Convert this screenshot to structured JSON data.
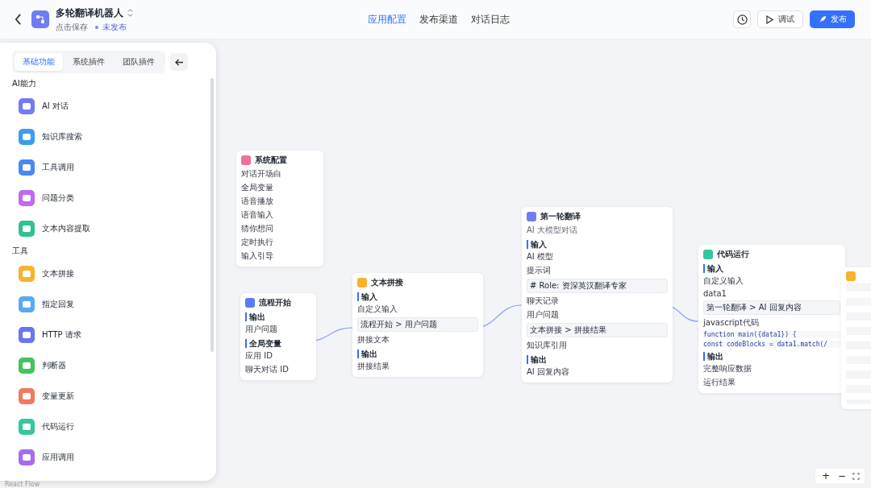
{
  "header": {
    "title": "多轮翻译机器人",
    "save_hint": "点击保存",
    "status": "未发布"
  },
  "tabs": [
    {
      "label": "应用配置",
      "selected": true
    },
    {
      "label": "发布渠道",
      "selected": false
    },
    {
      "label": "对话日志",
      "selected": false
    }
  ],
  "actions": {
    "debug": "调试",
    "publish": "发布"
  },
  "panel": {
    "tabs": [
      {
        "label": "基础功能",
        "selected": true
      },
      {
        "label": "系统插件",
        "selected": false
      },
      {
        "label": "团队插件",
        "selected": false
      }
    ],
    "groups": [
      {
        "title": "AI能力",
        "items": [
          {
            "label": "AI 对话",
            "color": "#717cf5"
          },
          {
            "label": "知识库搜索",
            "color": "#3a9df2"
          },
          {
            "label": "工具调用",
            "color": "#4b87f0"
          },
          {
            "label": "问题分类",
            "color": "#c06af0"
          },
          {
            "label": "文本内容提取",
            "color": "#2ec28f"
          }
        ]
      },
      {
        "title": "工具",
        "items": [
          {
            "label": "文本拼接",
            "color": "#f7b32b"
          },
          {
            "label": "指定回复",
            "color": "#5aa8f5"
          },
          {
            "label": "HTTP 请求",
            "color": "#6c74f2"
          },
          {
            "label": "判断器",
            "color": "#46c25f"
          },
          {
            "label": "变量更新",
            "color": "#ef7a5f"
          },
          {
            "label": "代码运行",
            "color": "#36c6a0"
          },
          {
            "label": "应用调用",
            "color": "#a66cf0"
          }
        ]
      }
    ]
  },
  "nodes": [
    {
      "title": "系统配置",
      "color": "#f0709c",
      "rows": [
        {
          "kind": "label",
          "text": "对话开场白"
        },
        {
          "kind": "label",
          "text": "全局变量"
        },
        {
          "kind": "label",
          "text": "语音播放"
        },
        {
          "kind": "label",
          "text": "语音输入"
        },
        {
          "kind": "label",
          "text": "猜你想问"
        },
        {
          "kind": "label",
          "text": "定时执行"
        },
        {
          "kind": "label",
          "text": "输入引导"
        }
      ]
    },
    {
      "title": "流程开始",
      "color": "#5b7cf2",
      "rows": [
        {
          "kind": "section",
          "text": "输出"
        },
        {
          "kind": "label",
          "text": "用户问题"
        },
        {
          "kind": "section",
          "text": "全局变量"
        },
        {
          "kind": "label",
          "text": "应用 ID"
        },
        {
          "kind": "label",
          "text": "聊天对话 ID"
        }
      ]
    },
    {
      "title": "文本拼接",
      "color": "#f7b32b",
      "rows": [
        {
          "kind": "section",
          "text": "输入"
        },
        {
          "kind": "label",
          "text": "自定义输入"
        },
        {
          "kind": "box",
          "text": "流程开始 > 用户问题"
        },
        {
          "kind": "label",
          "text": "拼接文本"
        },
        {
          "kind": "section",
          "text": "输出"
        },
        {
          "kind": "label",
          "text": "拼接结果"
        }
      ]
    },
    {
      "title": "第一轮翻译",
      "color": "#717cf5",
      "desc": "AI 大模型对话",
      "rows": [
        {
          "kind": "section",
          "text": "输入"
        },
        {
          "kind": "label",
          "text": "AI 模型"
        },
        {
          "kind": "label",
          "text": "提示词"
        },
        {
          "kind": "box",
          "text": "# Role: 资深英汉翻译专家"
        },
        {
          "kind": "label",
          "text": "聊天记录"
        },
        {
          "kind": "label",
          "text": "用户问题"
        },
        {
          "kind": "box",
          "text": "文本拼接 > 拼接结果"
        },
        {
          "kind": "label",
          "text": "知识库引用"
        },
        {
          "kind": "section",
          "text": "输出"
        },
        {
          "kind": "label",
          "text": "AI 回复内容"
        }
      ]
    },
    {
      "title": "代码运行",
      "color": "#36c6a0",
      "rows": [
        {
          "kind": "section",
          "text": "输入"
        },
        {
          "kind": "label",
          "text": "自定义输入"
        },
        {
          "kind": "label",
          "text": "data1"
        },
        {
          "kind": "box",
          "text": "第一轮翻译 > AI 回复内容"
        },
        {
          "kind": "label",
          "text": "javascript代码"
        },
        {
          "kind": "code",
          "text": "function main({data1}) {"
        },
        {
          "kind": "code",
          "text": "const codeBlocks = data1.match(/"
        },
        {
          "kind": "section",
          "text": "输出"
        },
        {
          "kind": "label",
          "text": "完整响应数据"
        },
        {
          "kind": "label",
          "text": "运行结果"
        }
      ]
    },
    {
      "color": "#f7b32b"
    }
  ],
  "zoom_controls": [
    "+",
    "−"
  ],
  "attribution": "React Flow"
}
